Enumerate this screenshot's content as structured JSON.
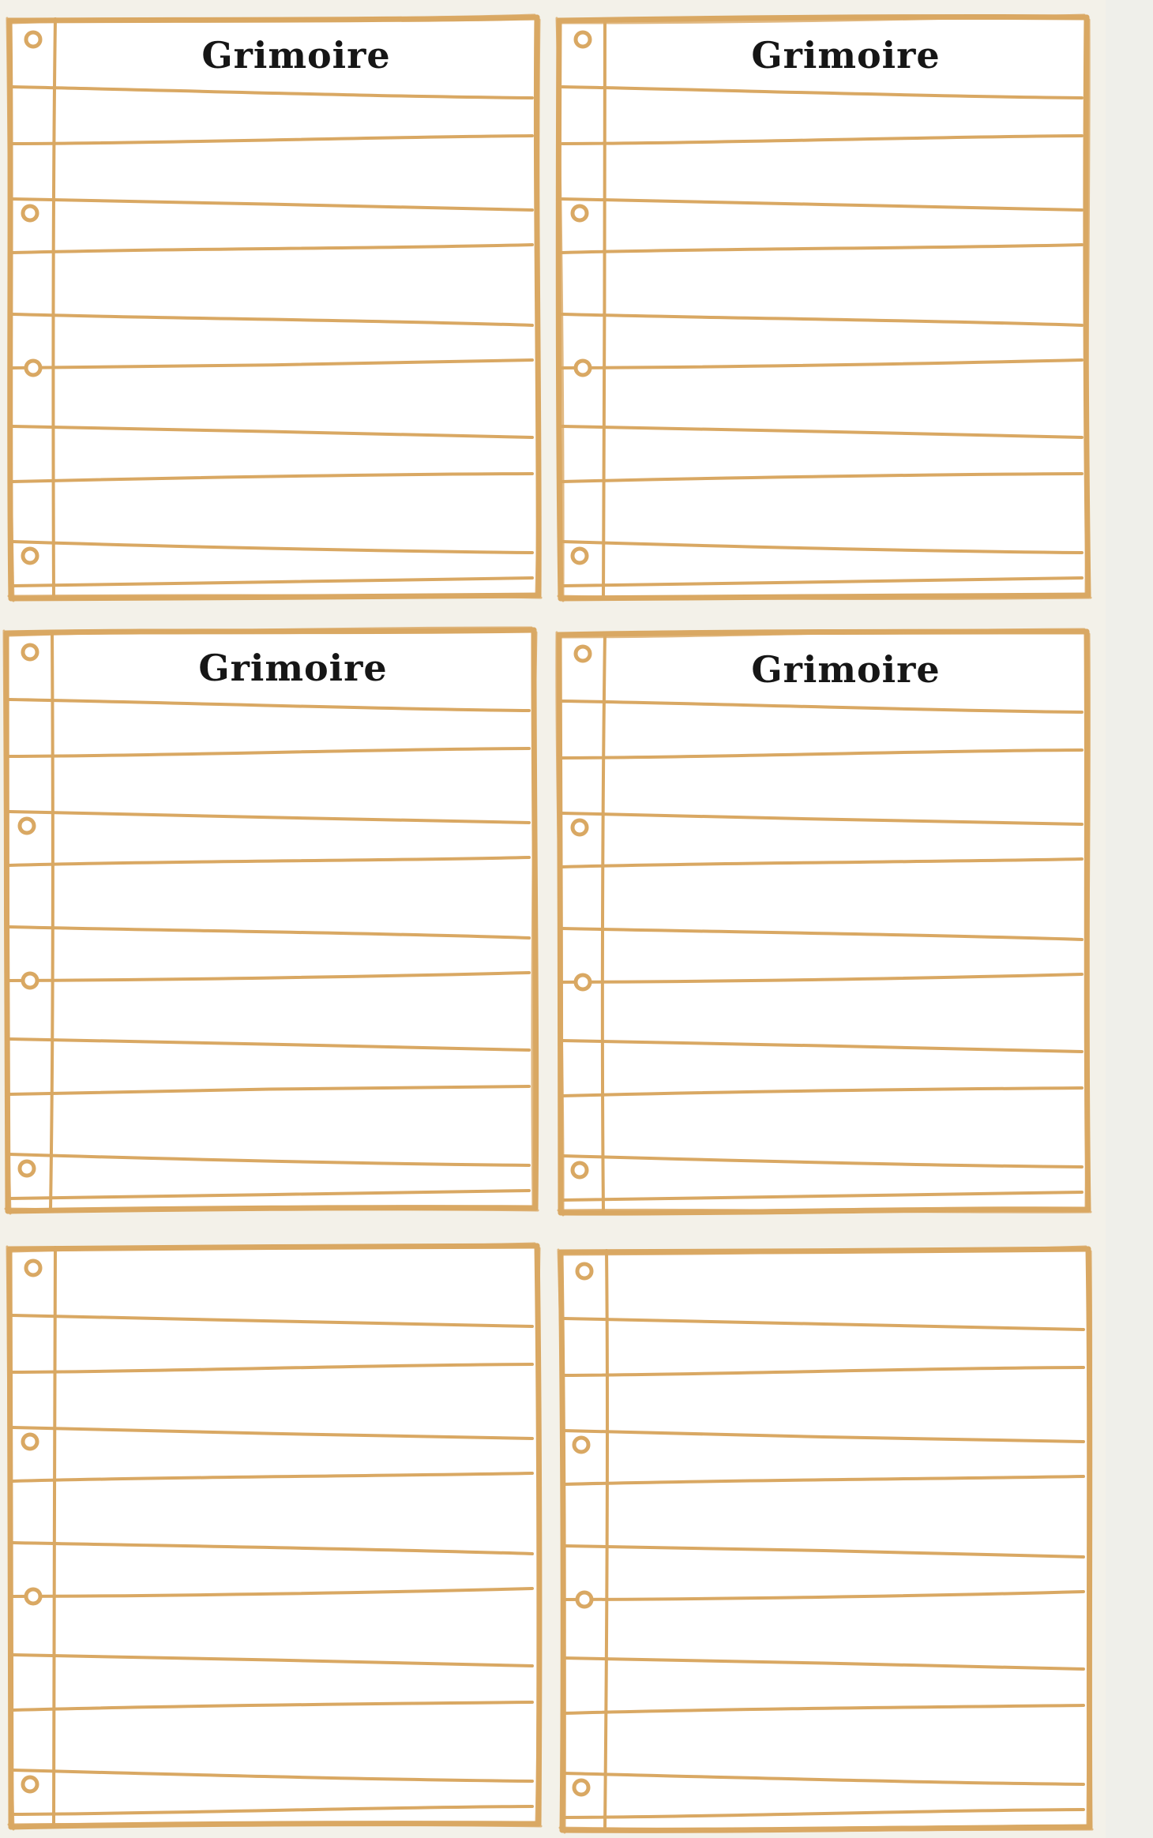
{
  "sheet": {
    "background_color": "#f3f1e9",
    "paper_color": "#ffffff",
    "line_color": "#d9a863",
    "title_color": "#161616"
  },
  "cards": [
    {
      "title": "Grimoire"
    },
    {
      "title": "Grimoire"
    },
    {
      "title": "Grimoire"
    },
    {
      "title": "Grimoire"
    },
    {
      "title": ""
    },
    {
      "title": ""
    }
  ]
}
